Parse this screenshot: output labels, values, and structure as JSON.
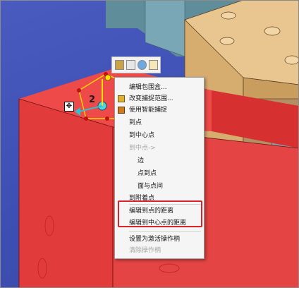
{
  "toolbar": {
    "icons": [
      "box-icon",
      "properties-icon",
      "globe-icon",
      "list-icon"
    ]
  },
  "gizmo": {
    "label": "2",
    "handle_icon": "move-handle-icon"
  },
  "context_menu": {
    "items": [
      {
        "label": "编辑包围盒...",
        "icon": "",
        "enabled": true
      },
      {
        "label": "改变捕捉范围...",
        "icon": "snap-range-icon",
        "enabled": true
      },
      {
        "label": "使用智能捕捉",
        "icon": "smart-snap-icon",
        "enabled": true
      },
      {
        "label": "到点",
        "icon": "",
        "enabled": true
      },
      {
        "label": "到中心点",
        "icon": "",
        "enabled": true
      },
      {
        "label": "到中点->",
        "icon": "",
        "enabled": false
      },
      {
        "label": "边",
        "icon": "",
        "enabled": true,
        "indent": true
      },
      {
        "label": "点到点",
        "icon": "",
        "enabled": true,
        "indent": true
      },
      {
        "label": "面与点间",
        "icon": "",
        "enabled": true,
        "indent": true
      },
      {
        "label": "到附着点",
        "icon": "",
        "enabled": true
      },
      {
        "label": "编辑到点的距离",
        "icon": "",
        "enabled": true
      },
      {
        "label": "编辑到中心点的距离",
        "icon": "",
        "enabled": true
      },
      {
        "label": "设置为激活操作柄",
        "icon": "",
        "enabled": true
      },
      {
        "label": "清除操作柄",
        "icon": "",
        "enabled": false
      }
    ]
  },
  "colors": {
    "highlight": "#d8242a",
    "model_face": "#e83a3a",
    "model_side": "#b82a2a",
    "background": "#4050b5"
  }
}
